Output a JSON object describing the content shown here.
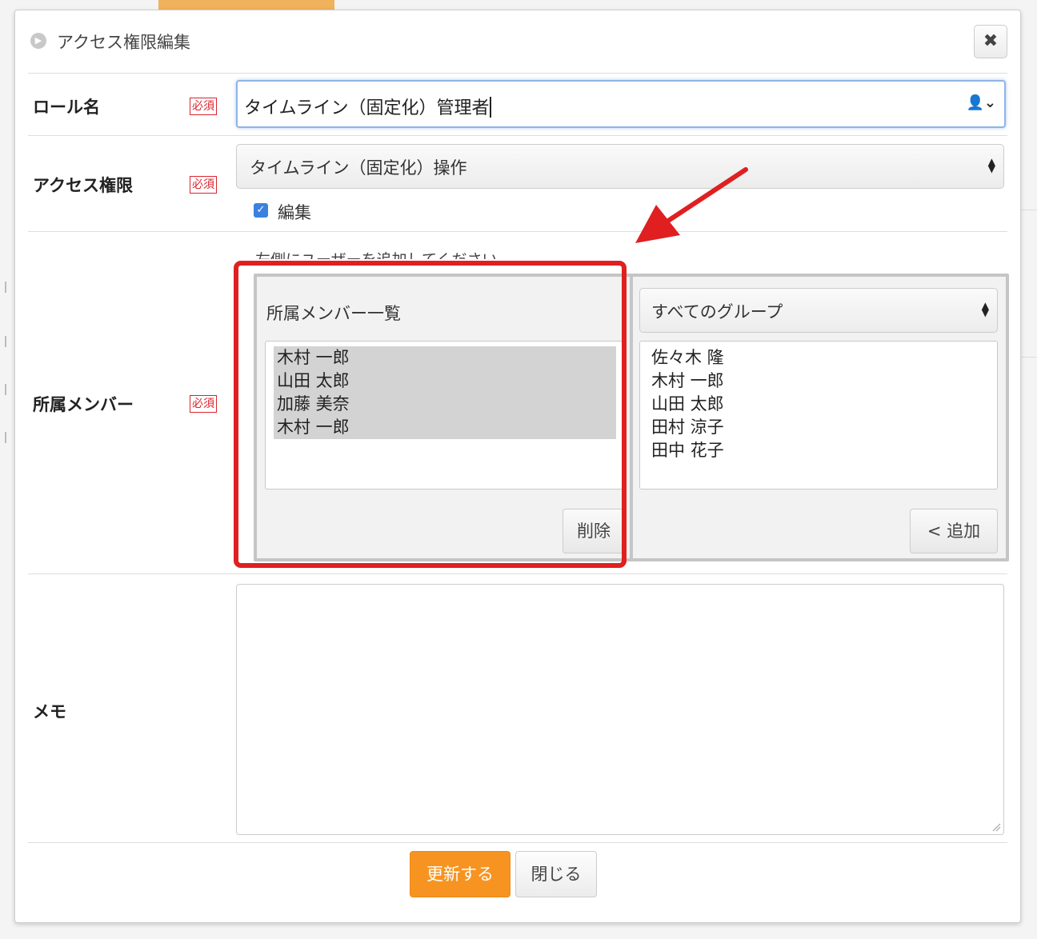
{
  "modal": {
    "title": "アクセス権限編集",
    "close_icon": "close-icon"
  },
  "role": {
    "label": "ロール名",
    "required": "必須",
    "value": "タイムライン（固定化）管理者"
  },
  "access": {
    "label": "アクセス権限",
    "required": "必須",
    "selected": "タイムライン（固定化）操作",
    "checkbox_label": "編集",
    "checkbox_checked": true
  },
  "members": {
    "label": "所属メンバー",
    "required": "必須",
    "hint": "左側にユーザーを追加してください。",
    "left_title": "所属メンバー一覧",
    "left_items": [
      "木村 一郎",
      "山田 太郎",
      "加藤 美奈",
      "木村 一郎"
    ],
    "remove_label": "削除",
    "group_select": "すべてのグループ",
    "right_items": [
      "佐々木 隆",
      "木村 一郎",
      "山田 太郎",
      "田村 涼子",
      "田中 花子"
    ],
    "add_label": "< 追加"
  },
  "memo": {
    "label": "メモ",
    "value": ""
  },
  "footer": {
    "update_label": "更新する",
    "close_label": "閉じる"
  },
  "colors": {
    "primary": "#f79421",
    "highlight": "#e02020",
    "required": "#d9232d",
    "checkbox": "#3b82e0"
  }
}
